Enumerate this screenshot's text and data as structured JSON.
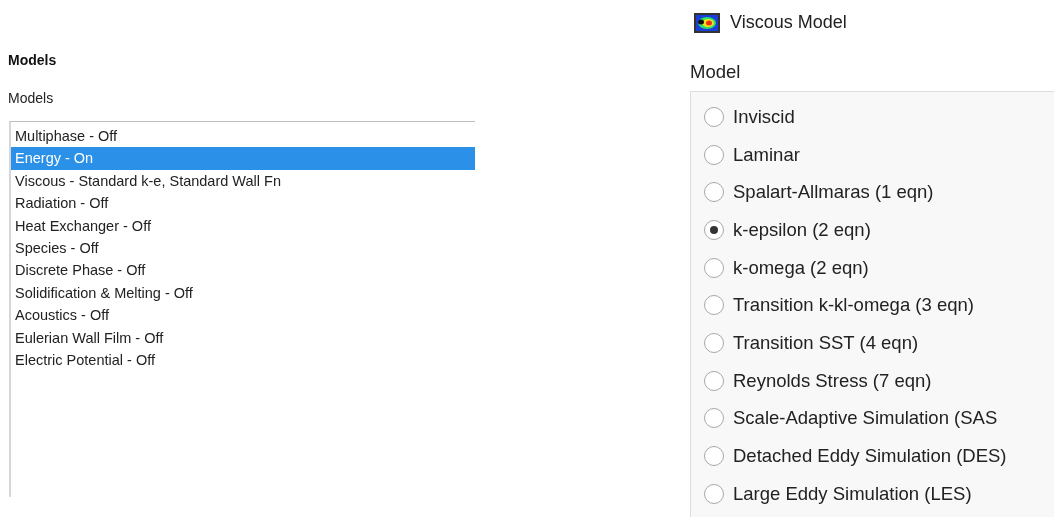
{
  "models_panel": {
    "heading": "Models",
    "list_label": "Models",
    "items": [
      {
        "label": "Multiphase - Off",
        "selected": false
      },
      {
        "label": "Energy - On",
        "selected": true
      },
      {
        "label": "Viscous - Standard k-e, Standard Wall Fn",
        "selected": false
      },
      {
        "label": "Radiation - Off",
        "selected": false
      },
      {
        "label": "Heat Exchanger - Off",
        "selected": false
      },
      {
        "label": "Species - Off",
        "selected": false
      },
      {
        "label": "Discrete Phase - Off",
        "selected": false
      },
      {
        "label": "Solidification & Melting - Off",
        "selected": false
      },
      {
        "label": "Acoustics - Off",
        "selected": false
      },
      {
        "label": "Eulerian Wall Film - Off",
        "selected": false
      },
      {
        "label": "Electric Potential - Off",
        "selected": false
      }
    ]
  },
  "dialog": {
    "title": "Viscous Model",
    "group_label": "Model",
    "options": [
      {
        "label": "Inviscid",
        "selected": false
      },
      {
        "label": "Laminar",
        "selected": false
      },
      {
        "label": "Spalart-Allmaras (1 eqn)",
        "selected": false
      },
      {
        "label": "k-epsilon (2 eqn)",
        "selected": true
      },
      {
        "label": "k-omega (2 eqn)",
        "selected": false
      },
      {
        "label": "Transition k-kl-omega (3 eqn)",
        "selected": false
      },
      {
        "label": "Transition SST (4 eqn)",
        "selected": false
      },
      {
        "label": "Reynolds Stress (7 eqn)",
        "selected": false
      },
      {
        "label": "Scale-Adaptive Simulation (SAS",
        "selected": false
      },
      {
        "label": "Detached Eddy Simulation (DES)",
        "selected": false
      },
      {
        "label": "Large Eddy Simulation (LES)",
        "selected": false
      }
    ]
  }
}
